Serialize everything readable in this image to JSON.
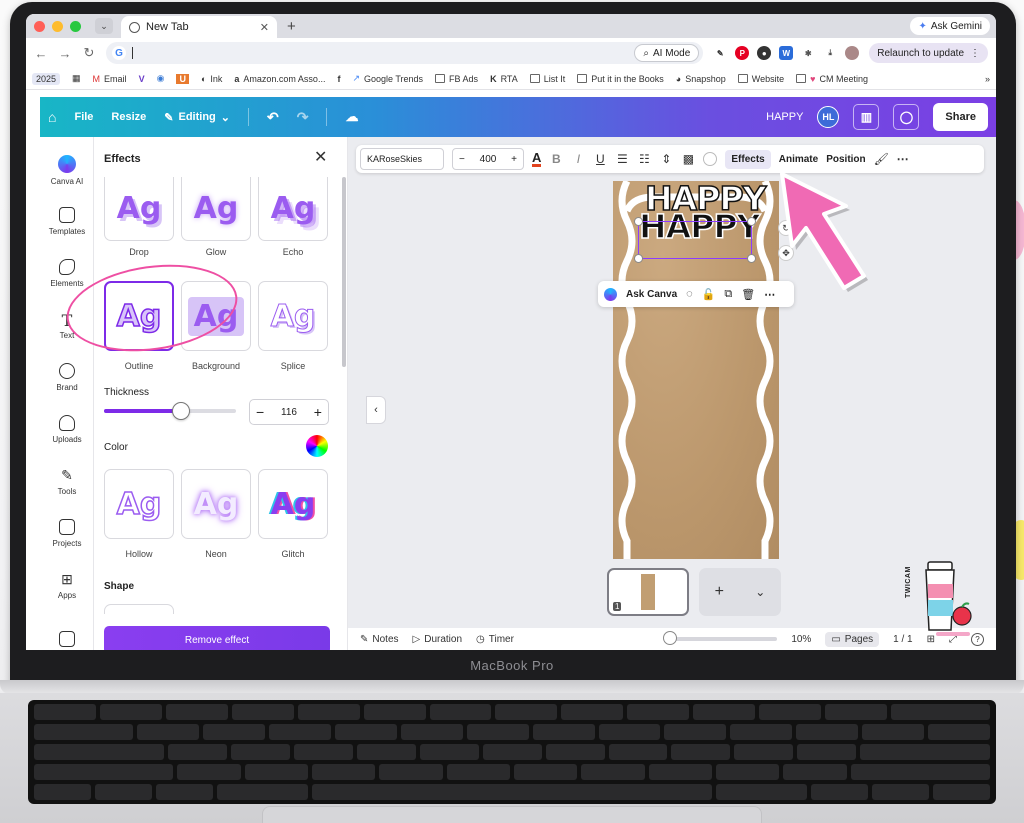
{
  "laptop": {
    "brand": "MacBook Pro"
  },
  "browser": {
    "tab_title": "New Tab",
    "ask_gemini": "Ask Gemini",
    "ai_mode": "AI Mode",
    "relaunch": "Relaunch to update",
    "bookmarks": [
      "2025",
      "Email",
      "Ink",
      "Amazon.com Asso...",
      "Google Trends",
      "FB Ads",
      "RTA",
      "List It",
      "Put it in the Books",
      "Snapshop",
      "Website",
      "CM Meeting"
    ]
  },
  "canva_header": {
    "file": "File",
    "resize": "Resize",
    "editing": "Editing",
    "design_name": "HAPPY",
    "avatar_initials": "HL",
    "share": "Share"
  },
  "rail": {
    "items": [
      "Canva AI",
      "Templates",
      "Elements",
      "Text",
      "Brand",
      "Uploads",
      "Tools",
      "Projects",
      "Apps"
    ]
  },
  "effects_panel": {
    "title": "Effects",
    "styles_row1": [
      "Drop",
      "Glow",
      "Echo"
    ],
    "styles_row2": [
      "Outline",
      "Background",
      "Splice"
    ],
    "tile_text": "Ag",
    "thickness_label": "Thickness",
    "thickness_value": "116",
    "thickness_fraction": 0.58,
    "color_label": "Color",
    "styles_row3": [
      "Hollow",
      "Neon",
      "Glitch"
    ],
    "shape_label": "Shape",
    "remove_effect": "Remove effect",
    "selected_style": "Outline"
  },
  "context_toolbar": {
    "font": "KARoseSkies",
    "font_size": "400",
    "effects": "Effects",
    "animate": "Animate",
    "position": "Position"
  },
  "canvas": {
    "text_line1": "HAPPY",
    "text_line2": "HAPPY",
    "ask_canva": "Ask Canva"
  },
  "thumbnails": {
    "page_number": "1"
  },
  "bottom_bar": {
    "notes": "Notes",
    "duration": "Duration",
    "timer": "Timer",
    "zoom": "10%",
    "pages": "Pages",
    "page_count": "1 / 1"
  },
  "decoration": {
    "brand_mark": "TWICAM"
  },
  "colors": {
    "accent_purple": "#7d2ae8",
    "annotation_pink": "#ee4fa3",
    "kraft_paper": "#bb976c"
  }
}
